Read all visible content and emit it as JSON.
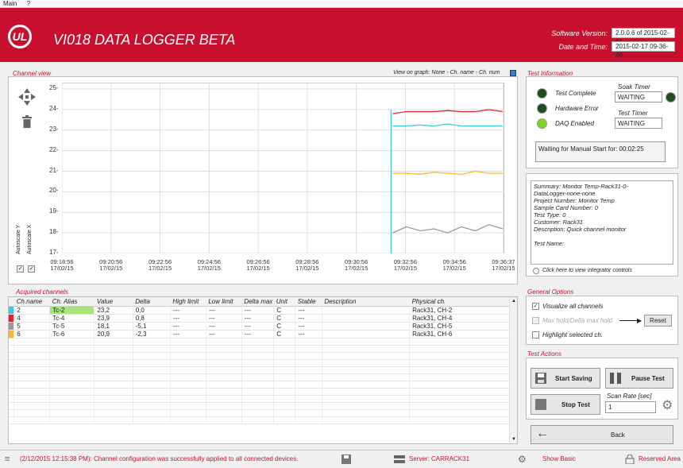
{
  "menu": [
    "Main",
    "?"
  ],
  "header": {
    "logo": "UL",
    "title": "VI018 DATA LOGGER BETA",
    "software_version_label": "Software Version:",
    "software_version": "2.0.0.6 of 2015-02-11",
    "datetime_label": "Date and Time:",
    "datetime": "2015-02-17 09-36-40"
  },
  "channel_view": {
    "title": "Channel view",
    "view_on_graph": "View on graph: None - Ch. name - Ch. num",
    "autoscale_y": "Autoscale Y",
    "autoscale_x": "Autoscale X"
  },
  "chart_data": {
    "type": "line",
    "y_ticks": [
      "25-",
      "24-",
      "23-",
      "22-",
      "21-",
      "20-",
      "19-",
      "18-",
      "17-"
    ],
    "x_ticks": [
      {
        "time": "09:18:56",
        "date": "17/02/15"
      },
      {
        "time": "09:20:56",
        "date": "17/02/15"
      },
      {
        "time": "09:22:56",
        "date": "17/02/15"
      },
      {
        "time": "09:24:56",
        "date": "17/02/15"
      },
      {
        "time": "09:26:56",
        "date": "17/02/15"
      },
      {
        "time": "09:28:56",
        "date": "17/02/15"
      },
      {
        "time": "09:30:56",
        "date": "17/02/15"
      },
      {
        "time": "09:32:56",
        "date": "17/02/15"
      },
      {
        "time": "09:34:56",
        "date": "17/02/15"
      },
      {
        "time": "09:36:37",
        "date": "17/02/15"
      }
    ],
    "ylim": [
      17,
      25
    ],
    "grid": true,
    "series": [
      {
        "color": "#e8202a",
        "values": [
          23.8,
          23.9,
          23.9,
          23.9,
          23.95,
          23.9,
          23.9,
          24.0,
          23.9
        ]
      },
      {
        "color": "#3cc9de",
        "values": [
          23.2,
          23.2,
          23.25,
          23.2,
          23.3,
          23.2,
          23.2,
          23.2,
          23.2
        ]
      },
      {
        "color": "#f5b82e",
        "values": [
          20.9,
          20.9,
          20.85,
          20.95,
          20.9,
          20.85,
          21.0,
          20.9,
          20.9
        ]
      },
      {
        "color": "#999999",
        "values": [
          18.0,
          18.3,
          18.1,
          18.2,
          18.0,
          18.3,
          18.1,
          18.4,
          18.2
        ]
      }
    ],
    "x_start_fraction": 0.744
  },
  "acquired": {
    "title": "Acquired channels",
    "columns": [
      "Ch.name",
      "Ch. Alias",
      "Value",
      "Delta",
      "High limit",
      "Low limit",
      "Delta max",
      "Unit",
      "Stable",
      "Description",
      "Physical ch."
    ],
    "rows": [
      {
        "color": "#3cc9de",
        "cells": [
          "2",
          "Tc-2",
          "23,2",
          "0,0",
          "---",
          "---",
          "---",
          "C",
          "---",
          "",
          "Rack31, CH-2"
        ]
      },
      {
        "color": "#e8202a",
        "cells": [
          "4",
          "Tc-4",
          "23,9",
          "0,8",
          "---",
          "---",
          "---",
          "C",
          "---",
          "",
          "Rack31, CH-4"
        ]
      },
      {
        "color": "#999999",
        "cells": [
          "5",
          "Tc-5",
          "18,1",
          "-5,1",
          "---",
          "---",
          "---",
          "C",
          "---",
          "",
          "Rack31, CH-5"
        ]
      },
      {
        "color": "#f5b82e",
        "cells": [
          "6",
          "Tc-6",
          "20,9",
          "-2,3",
          "---",
          "---",
          "---",
          "C",
          "---",
          "",
          "Rack31, CH-6"
        ]
      }
    ]
  },
  "test_info": {
    "title": "Test Information",
    "test_complete": "Test Complete",
    "hardware_error": "Hardware Error",
    "daq_enabled": "DAQ Enabled",
    "soak_timer_label": "Soak Timer",
    "soak_timer": "WAITING",
    "test_timer_label": "Test Timer",
    "test_timer": "WAITING",
    "message": "Waiting for Manual Start for: 00:02:25",
    "led_on_color": "#7ed321",
    "led_off_color": "#1e4d1e"
  },
  "summary": {
    "lines": [
      "Summary: Monitor Temp-Rack31-0-",
      "DataLogger-none-none",
      "Project Number: Monitor Temp",
      "Sample Card Number: 0",
      "Test Type: 0",
      "Customer: Rack31",
      "Description: Quick channel monitor",
      "",
      "Test Name:"
    ],
    "integrator_link": "Click here to view integrator controls"
  },
  "general_options": {
    "title": "General Options",
    "visualize_all": "Visualize all channels",
    "max_hold": "Max hold/Delta max hold",
    "reset": "Reset",
    "highlight": "Highlight selected ch."
  },
  "test_actions": {
    "title": "Test Actions",
    "start_saving": "Start Saving",
    "pause_test": "Pause Test",
    "stop_test": "Stop Test",
    "scan_rate_label": "Scan Rate [sec]",
    "scan_rate": "1",
    "back": "Back"
  },
  "status": {
    "message": "(2/12/2015 12:15:38 PM): Channel configuration was successfully applied to all connected devices.",
    "server": "Server: CARRACK31",
    "show_basic": "Show Basic",
    "reserved_area": "Reserved Area",
    "accent": "#c8102e"
  }
}
